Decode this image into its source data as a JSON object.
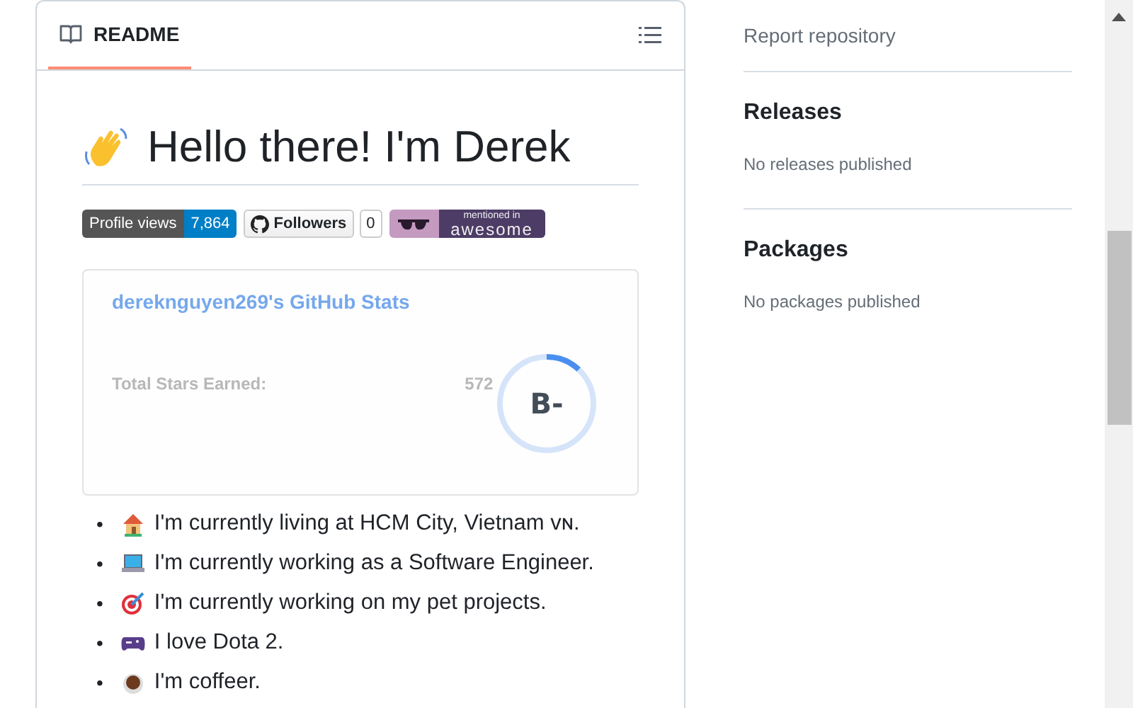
{
  "readme": {
    "tab": {
      "label": "README",
      "selected": true
    },
    "heading": "Hello there! I'm Derek",
    "badges": [
      {
        "kind": "views",
        "label": "Profile views",
        "value": "7,864"
      },
      {
        "kind": "followers",
        "label": "Followers",
        "value": "0"
      },
      {
        "kind": "awesome",
        "label": "mentioned in",
        "value": "awesome"
      }
    ],
    "stats_card": {
      "title": "dereknguyen269's GitHub Stats",
      "faded_label": "Total Stars Earned:",
      "faded_value": "572",
      "rank": "B-",
      "level": 0.12
    },
    "list": [
      {
        "kind": "house",
        "marker": "•",
        "text": "I'm currently living at HCM City, Vietnam ᴠɴ."
      },
      {
        "kind": "laptop",
        "marker": "•",
        "text": "I'm currently working as a Software Engineer."
      },
      {
        "kind": "target",
        "marker": "•",
        "text": "I'm currently working on my pet projects."
      },
      {
        "kind": "gamepad",
        "marker": "•",
        "text": "I love Dota 2."
      },
      {
        "kind": "coffee",
        "marker": "•",
        "text": "I'm coffeer."
      }
    ]
  },
  "sidebar": {
    "link": "Report repository",
    "sections": [
      {
        "title": "Releases",
        "text": "No releases published"
      },
      {
        "title": "Packages",
        "text": "No packages published"
      }
    ]
  }
}
